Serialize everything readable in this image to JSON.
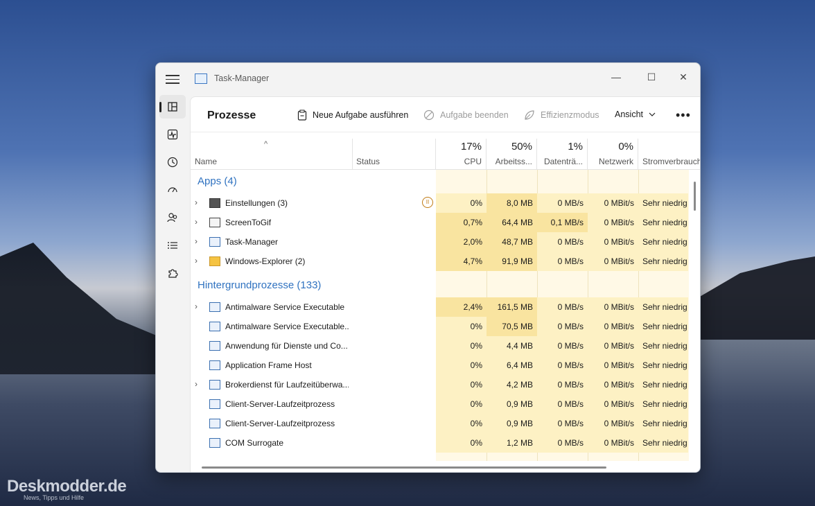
{
  "window": {
    "title": "Task-Manager",
    "controls": {
      "minimize": "—",
      "maximize": "☐",
      "close": "✕"
    }
  },
  "toolbar": {
    "page_title": "Prozesse",
    "new_task": "Neue Aufgabe ausführen",
    "end_task": "Aufgabe beenden",
    "efficiency": "Effizienzmodus",
    "view": "Ansicht",
    "more": "•••"
  },
  "columns": {
    "name": "Name",
    "status": "Status",
    "cpu_pct": "17%",
    "cpu": "CPU",
    "mem_pct": "50%",
    "mem": "Arbeitss...",
    "disk_pct": "1%",
    "disk": "Datenträ...",
    "net_pct": "0%",
    "net": "Netzwerk",
    "power": "Stromverbrauch"
  },
  "groups": {
    "apps": "Apps (4)",
    "background": "Hintergrundprozesse (133)"
  },
  "apps": [
    {
      "name": "Einstellungen (3)",
      "cpu": "0%",
      "mem": "8,0 MB",
      "disk": "0 MB/s",
      "net": "0 MBit/s",
      "power": "Sehr niedrig"
    },
    {
      "name": "ScreenToGif",
      "cpu": "0,7%",
      "mem": "64,4 MB",
      "disk": "0,1 MB/s",
      "net": "0 MBit/s",
      "power": "Sehr niedrig"
    },
    {
      "name": "Task-Manager",
      "cpu": "2,0%",
      "mem": "48,7 MB",
      "disk": "0 MB/s",
      "net": "0 MBit/s",
      "power": "Sehr niedrig"
    },
    {
      "name": "Windows-Explorer (2)",
      "cpu": "4,7%",
      "mem": "91,9 MB",
      "disk": "0 MB/s",
      "net": "0 MBit/s",
      "power": "Sehr niedrig"
    }
  ],
  "background": [
    {
      "name": "Antimalware Service Executable",
      "cpu": "2,4%",
      "mem": "161,5 MB",
      "disk": "0 MB/s",
      "net": "0 MBit/s",
      "power": "Sehr niedrig"
    },
    {
      "name": "Antimalware Service Executable...",
      "cpu": "0%",
      "mem": "70,5 MB",
      "disk": "0 MB/s",
      "net": "0 MBit/s",
      "power": "Sehr niedrig"
    },
    {
      "name": "Anwendung für Dienste und Co...",
      "cpu": "0%",
      "mem": "4,4 MB",
      "disk": "0 MB/s",
      "net": "0 MBit/s",
      "power": "Sehr niedrig"
    },
    {
      "name": "Application Frame Host",
      "cpu": "0%",
      "mem": "6,4 MB",
      "disk": "0 MB/s",
      "net": "0 MBit/s",
      "power": "Sehr niedrig"
    },
    {
      "name": "Brokerdienst für Laufzeitüberwa...",
      "cpu": "0%",
      "mem": "4,2 MB",
      "disk": "0 MB/s",
      "net": "0 MBit/s",
      "power": "Sehr niedrig"
    },
    {
      "name": "Client-Server-Laufzeitprozess",
      "cpu": "0%",
      "mem": "0,9 MB",
      "disk": "0 MB/s",
      "net": "0 MBit/s",
      "power": "Sehr niedrig"
    },
    {
      "name": "Client-Server-Laufzeitprozess",
      "cpu": "0%",
      "mem": "0,9 MB",
      "disk": "0 MB/s",
      "net": "0 MBit/s",
      "power": "Sehr niedrig"
    },
    {
      "name": "COM Surrogate",
      "cpu": "0%",
      "mem": "1,2 MB",
      "disk": "0 MB/s",
      "net": "0 MBit/s",
      "power": "Sehr niedrig"
    }
  ],
  "watermark": {
    "title": "Deskmodder.de",
    "subtitle": "News, Tipps und Hilfe"
  }
}
